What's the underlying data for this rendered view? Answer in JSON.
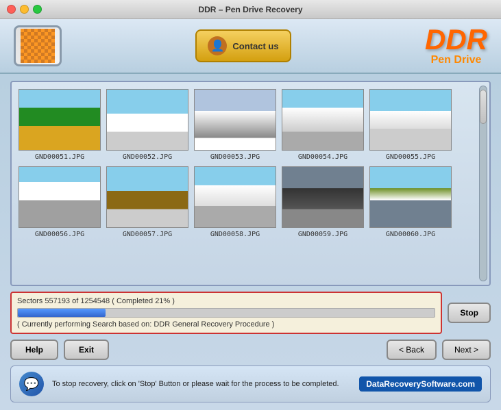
{
  "titlebar": {
    "title": "DDR – Pen Drive Recovery"
  },
  "header": {
    "contact_label": "Contact us",
    "brand_ddr": "DDR",
    "brand_sub": "Pen Drive"
  },
  "images": {
    "row1": [
      {
        "label": "GND00051.JPG",
        "class": "thumb-1"
      },
      {
        "label": "GND00052.JPG",
        "class": "thumb-2"
      },
      {
        "label": "GND00053.JPG",
        "class": "thumb-3"
      },
      {
        "label": "GND00054.JPG",
        "class": "thumb-4"
      },
      {
        "label": "GND00055.JPG",
        "class": "thumb-5"
      }
    ],
    "row2": [
      {
        "label": "GND00056.JPG",
        "class": "thumb-6"
      },
      {
        "label": "GND00057.JPG",
        "class": "thumb-7"
      },
      {
        "label": "GND00058.JPG",
        "class": "thumb-8"
      },
      {
        "label": "GND00059.JPG",
        "class": "thumb-9"
      },
      {
        "label": "GND00060.JPG",
        "class": "thumb-10"
      }
    ]
  },
  "progress": {
    "sectors_text": "Sectors 557193 of 1254548  ( Completed 21% )",
    "status_text": "( Currently performing Search based on: DDR General Recovery Procedure )",
    "fill_percent": 21,
    "stop_label": "Stop"
  },
  "buttons": {
    "help": "Help",
    "exit": "Exit",
    "back": "< Back",
    "next": "Next >"
  },
  "footer": {
    "message": "To stop recovery, click on 'Stop' Button or please wait for the process to be completed.",
    "url": "DataRecoverySoftware.com"
  }
}
